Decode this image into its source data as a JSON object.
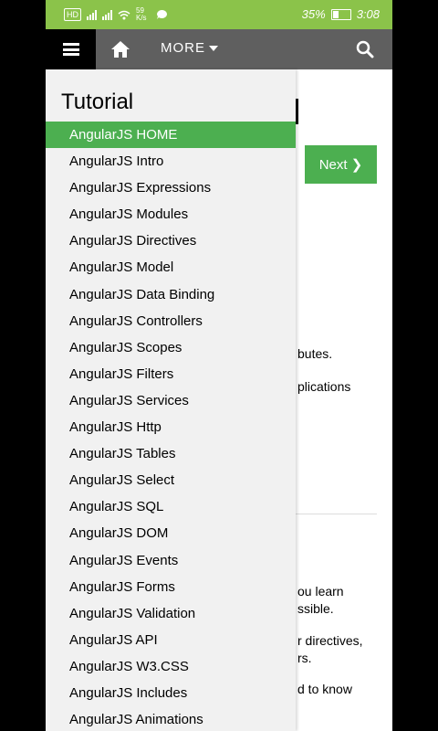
{
  "status_bar": {
    "chip": "HD",
    "speed": "59 K/s",
    "battery": "35%",
    "time": "3:08",
    "color": "#8bc34a"
  },
  "navbar": {
    "more_label": "MORE",
    "background": "#5f5f5f"
  },
  "content": {
    "next_label": "Next ❯",
    "fragments": [
      "butes.",
      "plications",
      "ou learn",
      "ssible.",
      "r directives,",
      "rs.",
      "d to know"
    ]
  },
  "drawer": {
    "title": "Tutorial",
    "items": [
      "AngularJS HOME",
      "AngularJS Intro",
      "AngularJS Expressions",
      "AngularJS Modules",
      "AngularJS Directives",
      "AngularJS Model",
      "AngularJS Data Binding",
      "AngularJS Controllers",
      "AngularJS Scopes",
      "AngularJS Filters",
      "AngularJS Services",
      "AngularJS Http",
      "AngularJS Tables",
      "AngularJS Select",
      "AngularJS SQL",
      "AngularJS DOM",
      "AngularJS Events",
      "AngularJS Forms",
      "AngularJS Validation",
      "AngularJS API",
      "AngularJS W3.CSS",
      "AngularJS Includes",
      "AngularJS Animations"
    ],
    "active_index": 0,
    "accent": "#4caf50"
  }
}
